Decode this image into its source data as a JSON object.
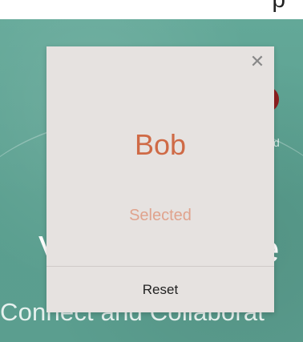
{
  "background": {
    "top_strip_text": "p",
    "small_letter": "d",
    "big_text_left": "V",
    "big_text_right": "e",
    "tagline": "Connect and Collaborat"
  },
  "dialog": {
    "close_icon": "close-icon",
    "name": "Bob",
    "status": "Selected",
    "reset_label": "Reset"
  },
  "colors": {
    "background_green": "#5fa595",
    "dialog_bg": "#e6e2e0",
    "name_color": "#cf6a46",
    "status_color": "#e0a38d"
  }
}
